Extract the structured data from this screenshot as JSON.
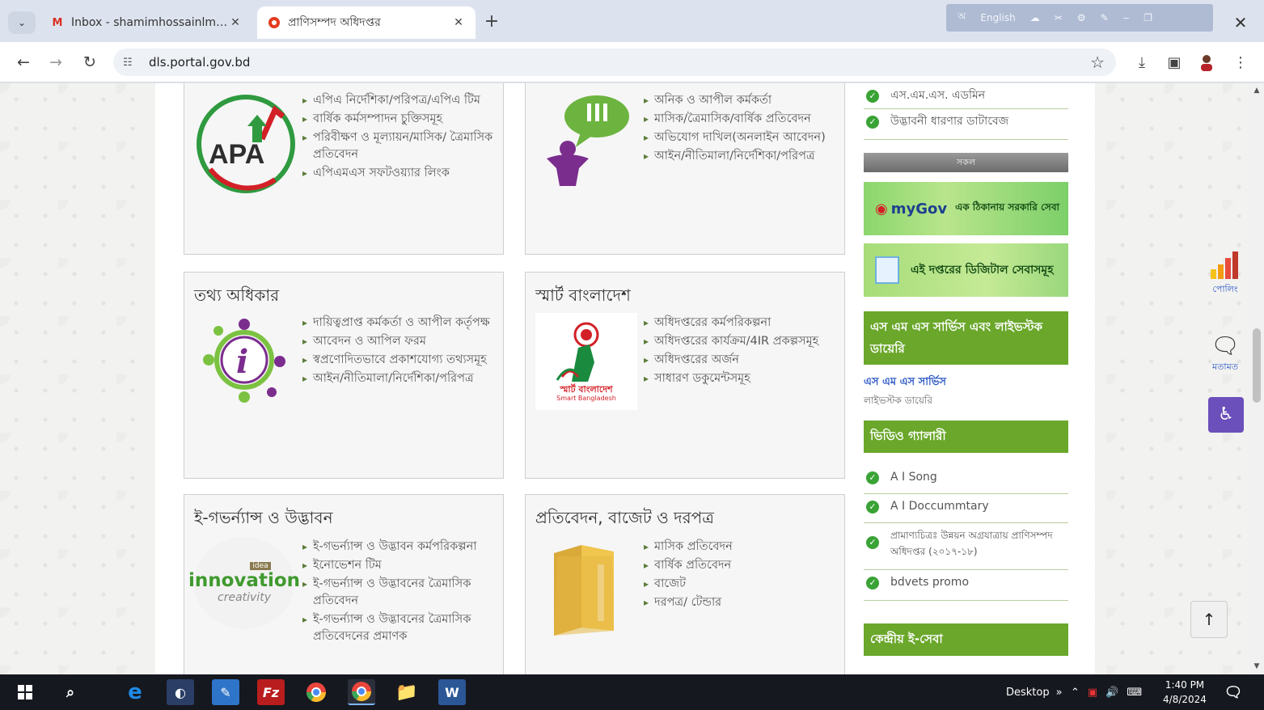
{
  "browser": {
    "tabs": [
      {
        "title": "Inbox - shamimhossainlms@gr",
        "favicon": "gmail-icon",
        "active": false
      },
      {
        "title": "প্রাণিসম্পদ অধিদপ্তর",
        "favicon": "site-icon",
        "active": true
      }
    ],
    "language_bar_label": "English",
    "url": "dls.portal.gov.bd"
  },
  "cards": [
    {
      "title": "",
      "links": [
        "এপিএ নির্দেশিকা/পরিপত্র/এপিএ টিম",
        "বার্ষিক কর্মসম্পাদন চুক্তিসমূহ",
        "পরিবীক্ষণ ও মূল্যায়ন/মাসিক/ ত্রৈমাসিক প্রতিবেদন",
        "এপিএমএস সফটওয়্যার লিংক"
      ],
      "image_text": "APA"
    },
    {
      "title": "",
      "links": [
        "অনিক ও আপীল কর্মকর্তা",
        "মাসিক/ত্রৈমাসিক/বার্ষিক প্রতিবেদন",
        "অভিযোগ দাখিল(অনলাইন আবেদন)",
        "আইন/নীতিমালা/নির্দেশিকা/পরিপত্র"
      ],
      "image_text": "!!!"
    },
    {
      "title": "তথ্য অধিকার",
      "links": [
        "দায়িত্বপ্রাপ্ত কর্মকর্তা ও আপীল কর্তৃপক্ষ",
        "আবেদন ও আপিল ফরম",
        "স্বপ্রণোদিতভাবে প্রকাশযোগ্য তথ্যসমূহ",
        "আইন/নীতিমালা/নির্দেশিকা/পরিপত্র"
      ],
      "image_text": "i"
    },
    {
      "title": "স্মার্ট বাংলাদেশ",
      "links": [
        "অধিদপ্তরের কর্মপরিকল্পনা",
        "অধিদপ্তরের কার্যক্রম/4IR প্রকল্পসমূহ",
        "অধিদপ্তরের অর্জন",
        "সাধারণ ডকুমেন্টসমূহ"
      ],
      "image_text": "স্মার্ট বাংলাদেশ",
      "image_subtext": "Smart Bangladesh"
    },
    {
      "title": "ই-গভর্ন্যান্স ও উদ্ভাবন",
      "links": [
        "ই-গভর্ন্যান্স ও উদ্ভাবন কর্মপরিকল্পনা",
        "ইনোভেশন টিম",
        "ই-গভর্ন্যান্স ও উদ্ভাবনের ত্রৈমাসিক প্রতিবেদন",
        "ই-গভর্ন্যান্স ও উদ্ভাবনের ত্রৈমাসিক প্রতিবেদনের প্রমাণক"
      ],
      "image_text": "innovation",
      "image_subtext": "creativity",
      "image_tag": "idea"
    },
    {
      "title": "প্রতিবেদন, বাজেট ও দরপত্র",
      "links": [
        "মাসিক প্রতিবেদন",
        "বার্ষিক প্রতিবেদন",
        "বাজেট",
        "দরপত্র/ টেন্ডার"
      ],
      "image_text": ""
    }
  ],
  "sidebar": {
    "top_items": [
      "এস.এম.এস. এডমিন",
      "উদ্ভাবনী ধারণার ডাটাবেজ"
    ],
    "gray_header": "সকল",
    "mygov_banner": {
      "brand": "myGov",
      "tagline": "এক ঠিকানায় সরকারি সেবা"
    },
    "digital_banner": "এই দপ্তরের ডিজিটাল সেবাসমূহ",
    "sms_header": "এস এম এস সার্ভিস এবং লাইভস্টক ডায়েরি",
    "sms_link": "এস এম এস সার্ভিস",
    "livestock_text": "লাইভস্টক ডায়েরি",
    "video_header": "ভিডিও গ্যালারী",
    "video_items": [
      "A I Song",
      "A I Doccummtary",
      "প্রামাণ্যচিত্রঃ উন্নয়ন অগ্রযাত্রায় প্রাণিসম্পদ অধিদপ্তর (২০১৭-১৮)",
      "bdvets promo"
    ],
    "central_header": "কেন্দ্রীয় ই-সেবা"
  },
  "floating": {
    "poll_label": "পোলিং",
    "feedback_label": "মতামত"
  },
  "taskbar": {
    "desktop_label": "Desktop",
    "time": "1:40 PM",
    "date": "4/8/2024"
  },
  "colors": {
    "accent_green": "#6aa72a",
    "check_green": "#3aa335",
    "link_blue": "#2a57c6"
  }
}
